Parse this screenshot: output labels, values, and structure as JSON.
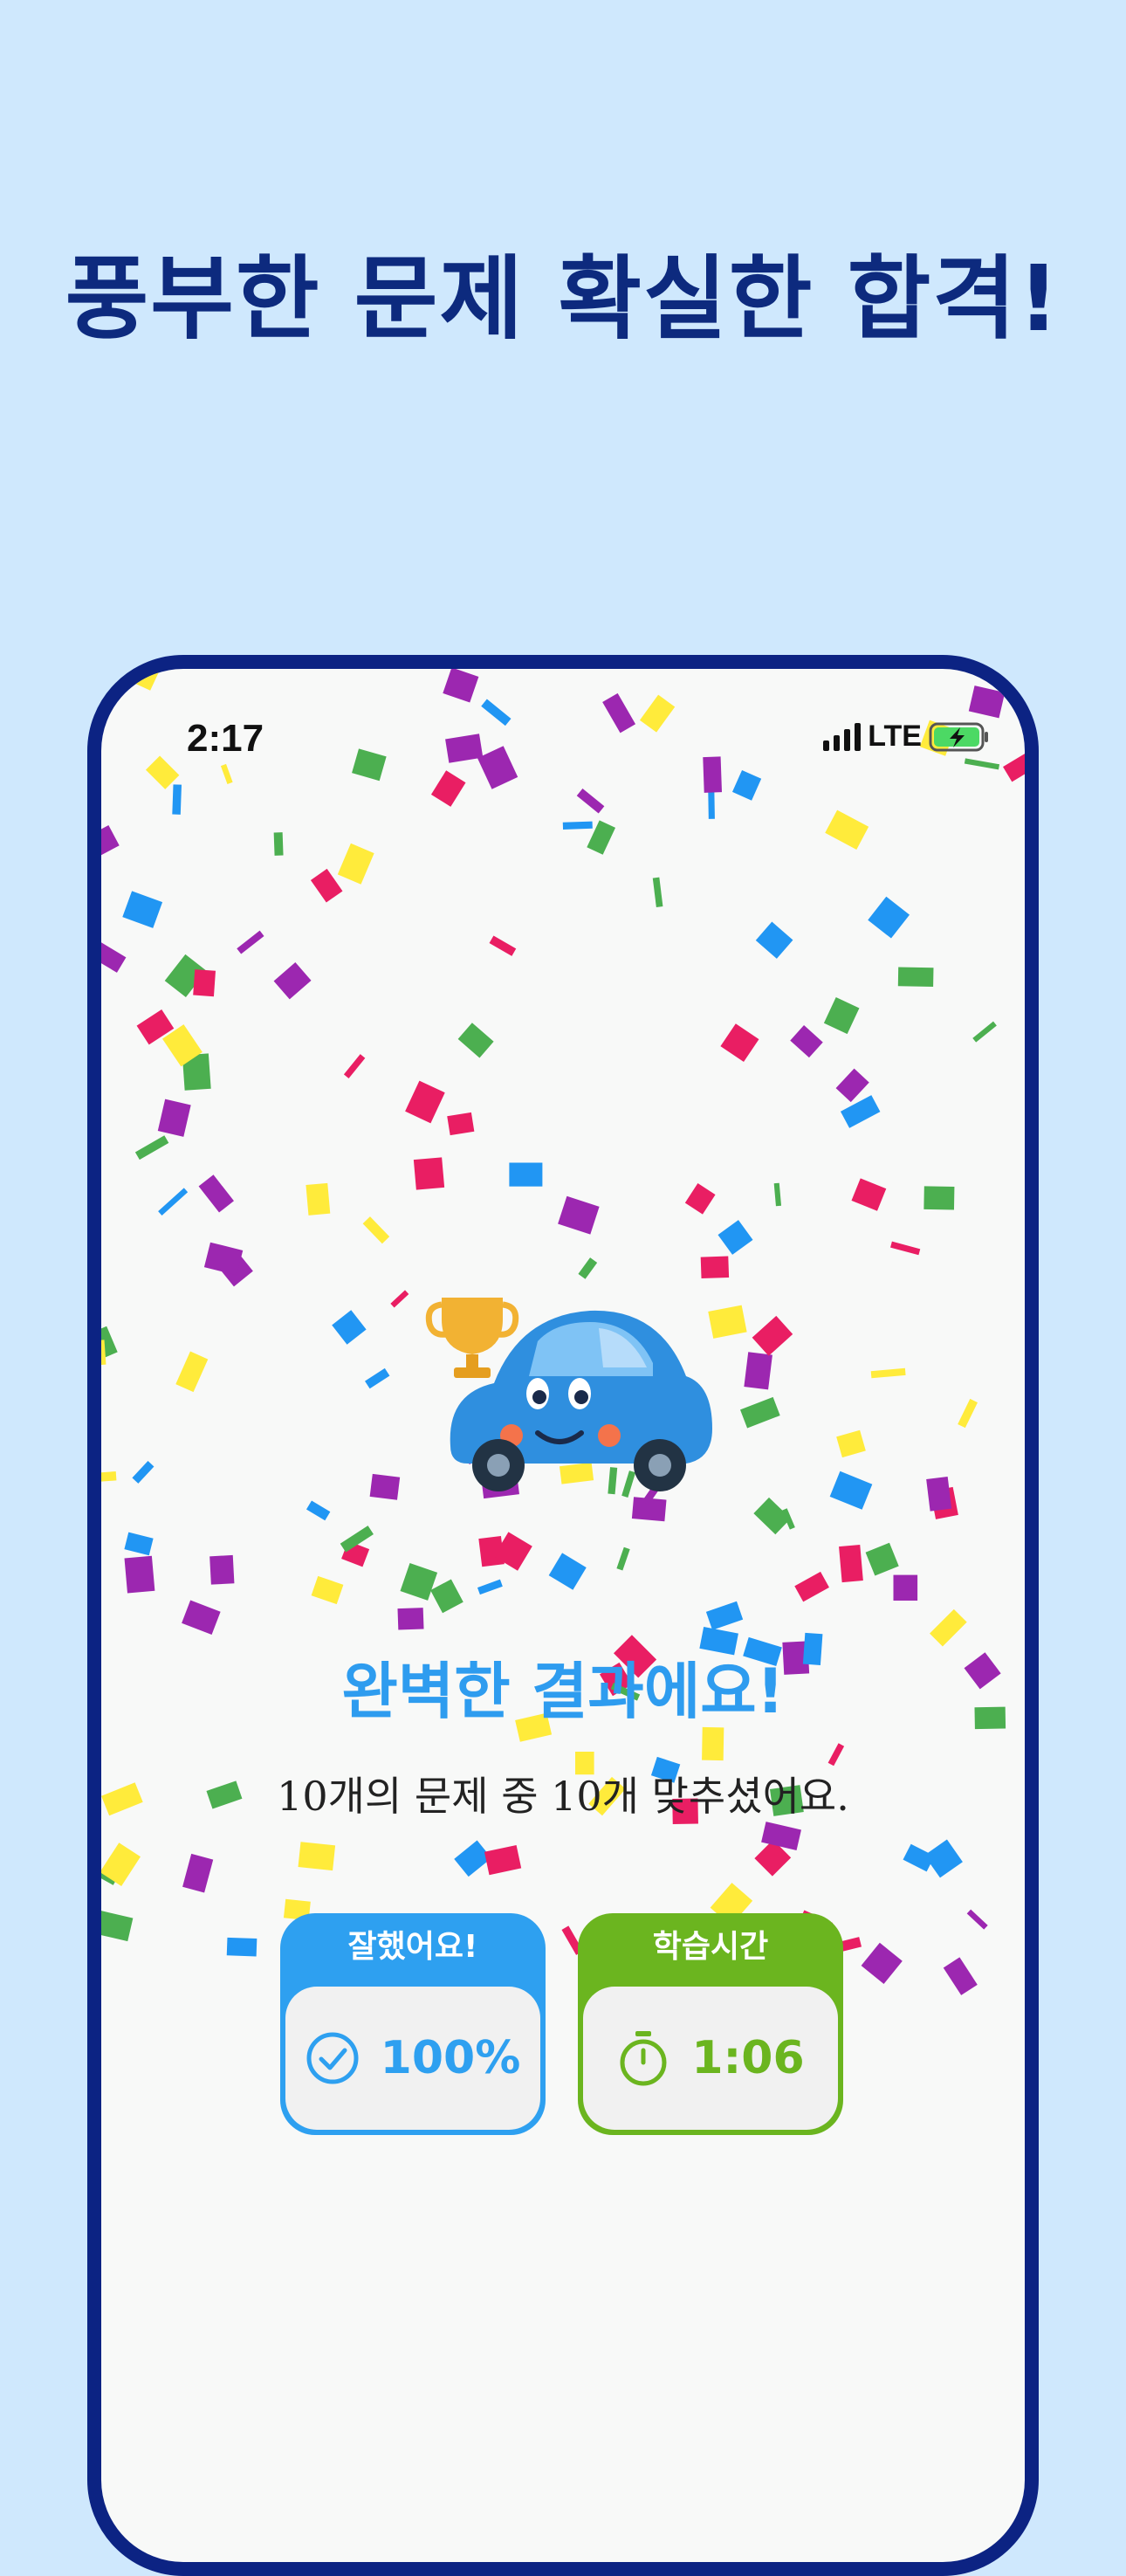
{
  "headline": "풍부한 문제 확실한 합격!",
  "status_bar": {
    "time": "2:17",
    "network": "LTE"
  },
  "result": {
    "title": "완벽한 결과에요!",
    "subtitle": "10개의 문제 중 10개 맞추셨어요."
  },
  "cards": {
    "accuracy": {
      "label": "잘했어요!",
      "value": "100%",
      "icon": "check-circle-icon"
    },
    "study_time": {
      "label": "학습시간",
      "value": "1:06",
      "icon": "stopwatch-icon"
    }
  },
  "colors": {
    "background": "#cfe8fd",
    "headline": "#0d2a7e",
    "phone_frame": "#0c2383",
    "accent_blue": "#2ea0f0",
    "accent_green": "#6bb51f",
    "battery_green": "#4cd964",
    "confetti": [
      "#e91e63",
      "#2196f3",
      "#4caf50",
      "#ffeb3b",
      "#9c27b0"
    ]
  },
  "decorations": {
    "mascot": "trophy-car-mascot",
    "effect": "confetti"
  }
}
